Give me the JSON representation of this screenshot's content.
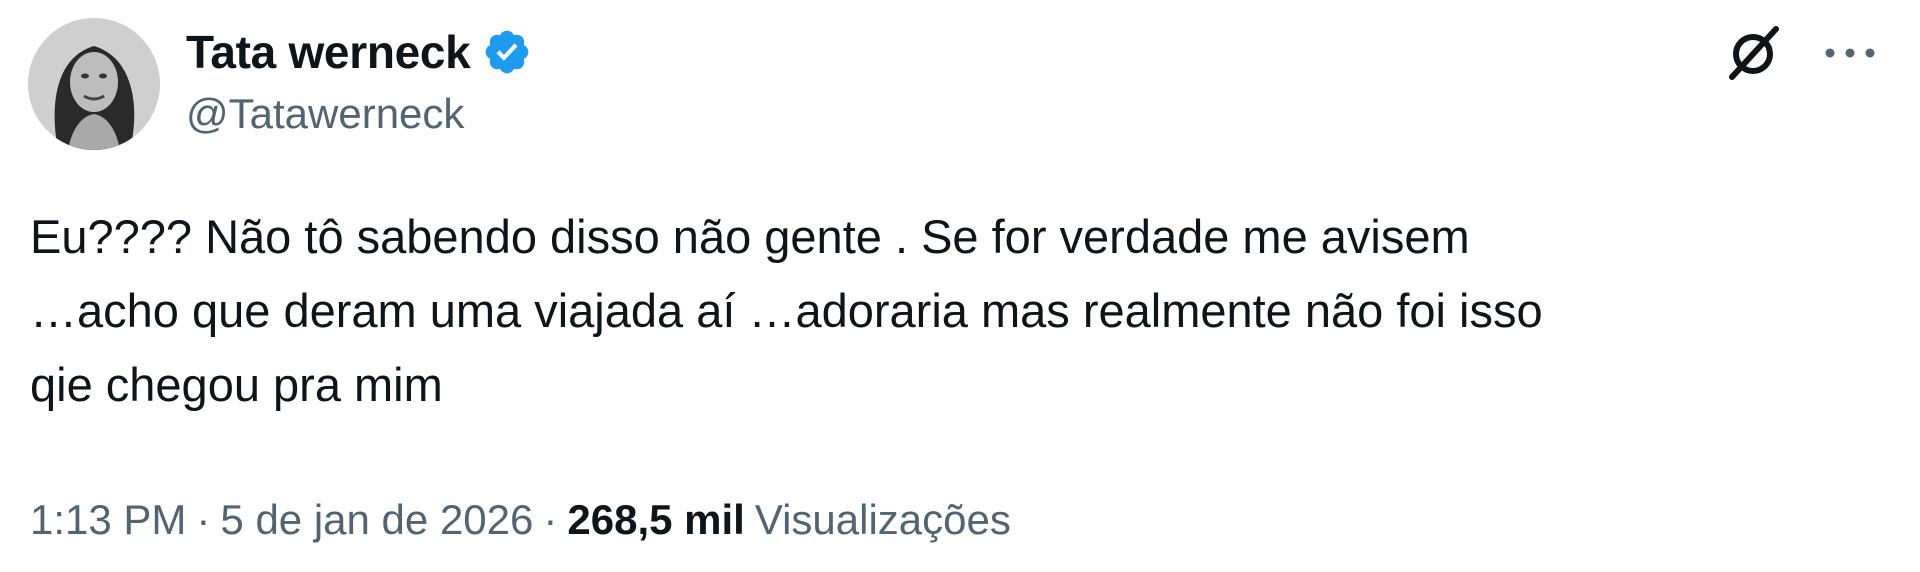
{
  "user": {
    "display_name": "Tata werneck",
    "handle": "@Tatawerneck",
    "verified": true,
    "badge_color": "#1d9bf0",
    "avatar": "profile-photo"
  },
  "actions": {
    "grok_icon": "grok-icon",
    "more_icon": "more-icon"
  },
  "tweet": {
    "lines": [
      "Eu???? Não tô sabendo disso não gente . Se for verdade me avisem",
      "…acho que deram uma viajada aí …adoraria mas realmente não foi isso",
      "qie chegou pra mim"
    ]
  },
  "meta": {
    "time": "1:13 PM",
    "separator": "·",
    "date": "5 de jan de 2026",
    "views_count": "268,5 mil",
    "views_label": "Visualizações"
  },
  "colors": {
    "text_primary": "#0f1419",
    "text_secondary": "#536471",
    "background": "#ffffff"
  }
}
